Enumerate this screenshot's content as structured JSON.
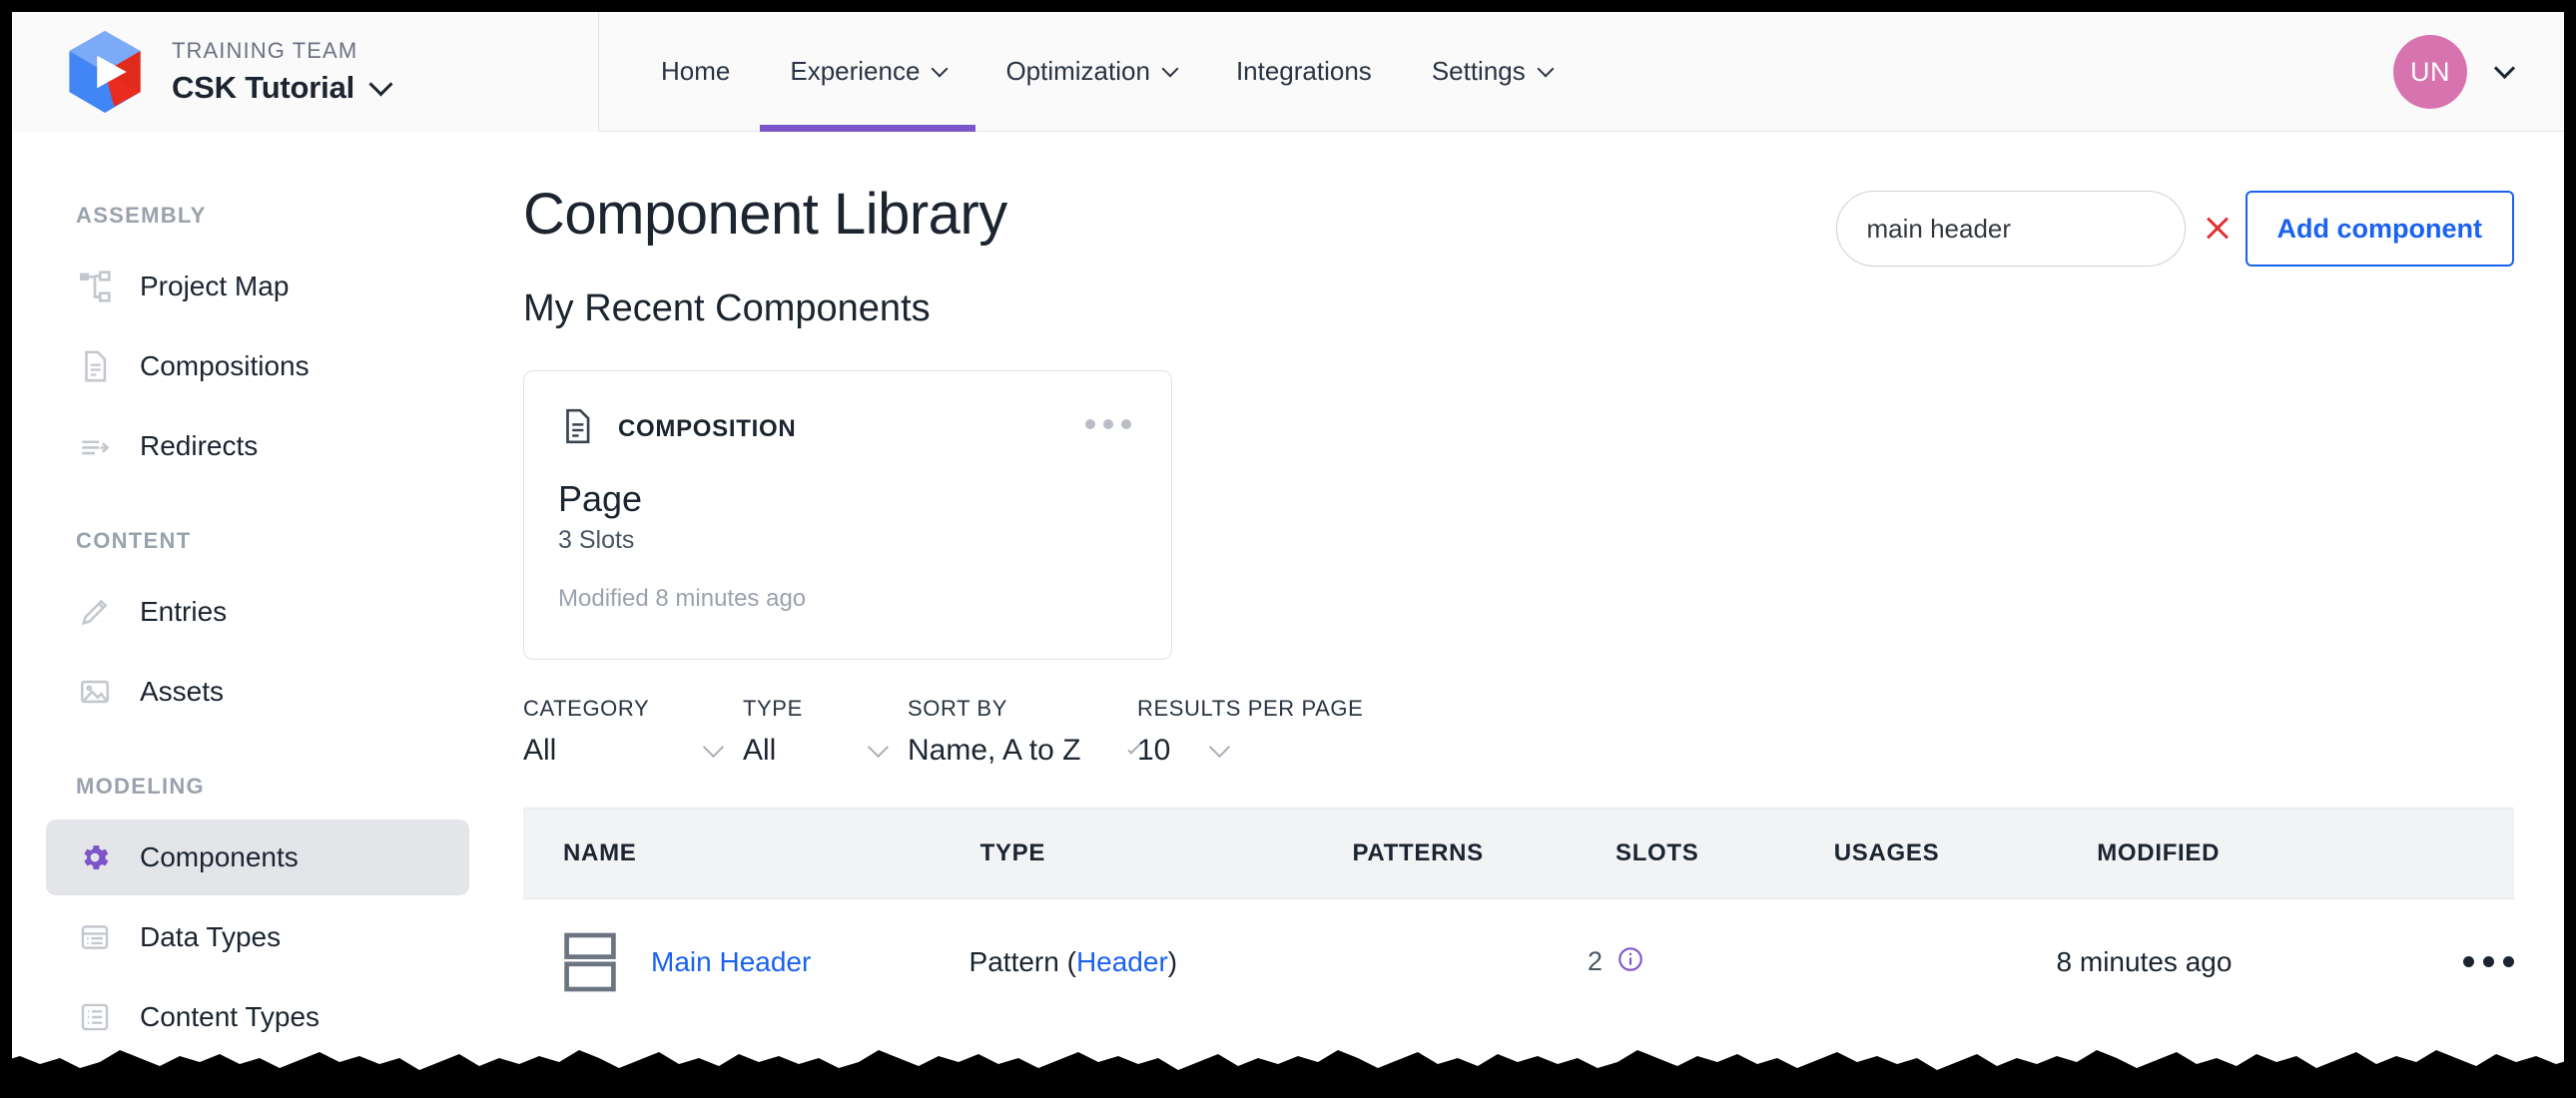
{
  "topbar": {
    "logo_icon": "cube-play-logo-icon",
    "team_label": "TRAINING TEAM",
    "team_name": "CSK Tutorial",
    "team_caret_icon": "chevron-down-icon",
    "nav": [
      {
        "label": "Home",
        "has_caret": false,
        "active": false
      },
      {
        "label": "Experience",
        "has_caret": true,
        "active": true
      },
      {
        "label": "Optimization",
        "has_caret": true,
        "active": false
      },
      {
        "label": "Integrations",
        "has_caret": false,
        "active": false
      },
      {
        "label": "Settings",
        "has_caret": true,
        "active": false
      }
    ],
    "avatar_initials": "UN",
    "avatar_color": "#d774b0",
    "user_caret_icon": "chevron-down-icon",
    "active_underline_color": "#7b55c9"
  },
  "sidebar": {
    "groups": [
      {
        "label": "ASSEMBLY",
        "items": [
          {
            "label": "Project Map",
            "icon": "sitemap-icon",
            "active": false
          },
          {
            "label": "Compositions",
            "icon": "document-icon",
            "active": false
          },
          {
            "label": "Redirects",
            "icon": "arrow-right-icon",
            "active": false
          }
        ]
      },
      {
        "label": "CONTENT",
        "items": [
          {
            "label": "Entries",
            "icon": "pencil-icon",
            "active": false
          },
          {
            "label": "Assets",
            "icon": "image-icon",
            "active": false
          }
        ]
      },
      {
        "label": "MODELING",
        "items": [
          {
            "label": "Components",
            "icon": "gear-icon",
            "active": true
          },
          {
            "label": "Data Types",
            "icon": "list-card-icon",
            "active": false
          },
          {
            "label": "Content Types",
            "icon": "list-icon",
            "active": false
          }
        ]
      }
    ],
    "active_icon_color": "#7b55c9"
  },
  "main": {
    "page_title": "Component Library",
    "subtitle": "My Recent Components",
    "search": {
      "value": "main header",
      "placeholder": "Search",
      "clear_icon": "close-x-icon",
      "clear_color": "#e03131"
    },
    "add_button": {
      "label": "Add component",
      "color": "#1a62ef"
    },
    "recent_card": {
      "type_icon": "document-icon",
      "type_label": "COMPOSITION",
      "menu_icon": "ellipsis-icon",
      "title": "Page",
      "slots": "3 Slots",
      "modified": "Modified 8 minutes ago"
    },
    "filters": [
      {
        "label": "CATEGORY",
        "value": "All",
        "caret_icon": "chevron-down-icon"
      },
      {
        "label": "TYPE",
        "value": "All",
        "caret_icon": "chevron-down-icon"
      },
      {
        "label": "SORT BY",
        "value": "Name, A to Z",
        "caret_icon": "chevron-down-icon"
      },
      {
        "label": "RESULTS PER PAGE",
        "value": "10",
        "caret_icon": "chevron-down-icon"
      }
    ],
    "table": {
      "columns": [
        "NAME",
        "TYPE",
        "PATTERNS",
        "SLOTS",
        "USAGES",
        "MODIFIED",
        ""
      ],
      "rows": [
        {
          "icon": "pattern-layout-icon",
          "name": "Main Header",
          "type_prefix": "Pattern (",
          "type_link": "Header",
          "type_suffix": ")",
          "patterns": "",
          "slots": "2",
          "slots_info_icon": "info-circle-icon",
          "slots_info_color": "#7b55c9",
          "usages": "",
          "modified": "8 minutes ago",
          "actions_icon": "ellipsis-icon"
        }
      ]
    }
  }
}
